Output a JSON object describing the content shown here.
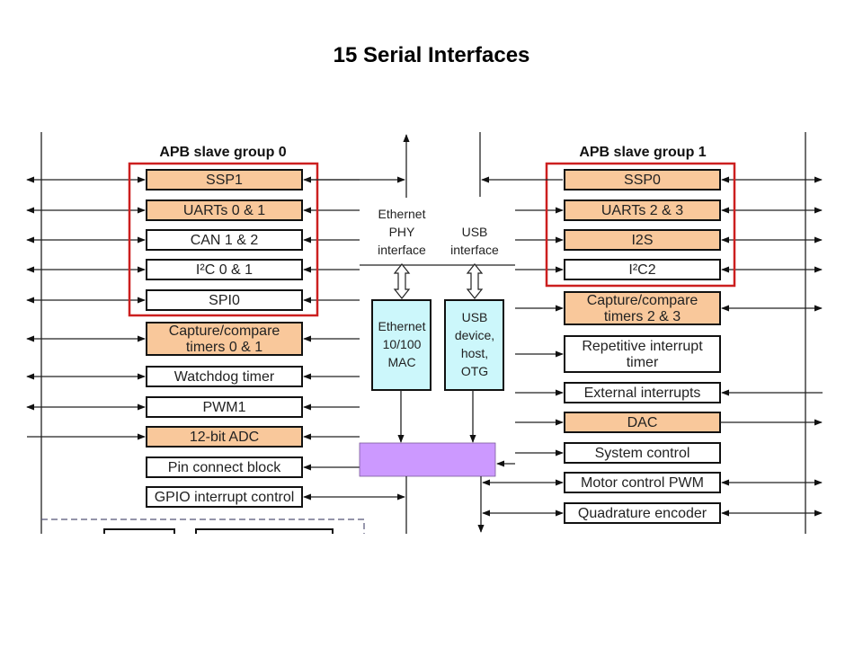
{
  "slide": {
    "title": "15 Serial Interfaces"
  },
  "colors": {
    "highlight": "#f9c89b",
    "plain": "#ffffff",
    "mac": "#ccf7fb",
    "bridge": "#cc99ff",
    "callout": "#cc1f1f",
    "stroke": "#111111",
    "dashed": "#555577"
  },
  "group0": {
    "title": "APB slave group 0",
    "blocks": [
      {
        "label": "SSP1",
        "highlight": true,
        "serial": true,
        "left": "both"
      },
      {
        "label": "UARTs 0 & 1",
        "highlight": true,
        "serial": true,
        "left": "both"
      },
      {
        "label": "CAN 1 & 2",
        "highlight": false,
        "serial": true,
        "left": "both"
      },
      {
        "label": "I²C 0 & 1",
        "highlight": false,
        "serial": true,
        "left": "both"
      },
      {
        "label": "SPI0",
        "highlight": false,
        "serial": true,
        "left": "both"
      },
      {
        "label": "Capture/compare|timers 0 & 1",
        "highlight": true,
        "serial": false,
        "left": "both"
      },
      {
        "label": "Watchdog timer",
        "highlight": false,
        "serial": false,
        "left": "both"
      },
      {
        "label": "PWM1",
        "highlight": false,
        "serial": false,
        "left": "both"
      },
      {
        "label": "12-bit ADC",
        "highlight": true,
        "serial": false,
        "left": "in"
      },
      {
        "label": "Pin connect block",
        "highlight": false,
        "serial": false,
        "left": "none"
      },
      {
        "label": "GPIO interrupt control",
        "highlight": false,
        "serial": false,
        "left": "none"
      }
    ]
  },
  "group1": {
    "title": "APB slave group 1",
    "blocks": [
      {
        "label": "SSP0",
        "highlight": true,
        "serial": true,
        "right": "both"
      },
      {
        "label": "UARTs 2 & 3",
        "highlight": true,
        "serial": true,
        "right": "both"
      },
      {
        "label": "I2S",
        "highlight": true,
        "serial": true,
        "right": "both"
      },
      {
        "label": "I²C2",
        "highlight": false,
        "serial": true,
        "right": "both"
      },
      {
        "label": "Capture/compare|timers 2 & 3",
        "highlight": true,
        "serial": false,
        "right": "both"
      },
      {
        "label": "Repetitive interrupt|timer",
        "highlight": false,
        "serial": false,
        "right": "none"
      },
      {
        "label": "External interrupts",
        "highlight": false,
        "serial": false,
        "right": "in"
      },
      {
        "label": "DAC",
        "highlight": true,
        "serial": false,
        "right": "out"
      },
      {
        "label": "System control",
        "highlight": false,
        "serial": false,
        "right": "none"
      },
      {
        "label": "Motor control PWM",
        "highlight": false,
        "serial": false,
        "right": "both"
      },
      {
        "label": "Quadrature encoder",
        "highlight": false,
        "serial": false,
        "right": "both"
      }
    ]
  },
  "middle": {
    "ethernet_phy": [
      "Ethernet",
      "PHY",
      "interface"
    ],
    "usb_interface": [
      "USB",
      "interface"
    ],
    "ethernet_mac": [
      "Ethernet",
      "10/100",
      "MAC"
    ],
    "usb_device": [
      "USB",
      "device,",
      "host,",
      "OTG"
    ]
  }
}
